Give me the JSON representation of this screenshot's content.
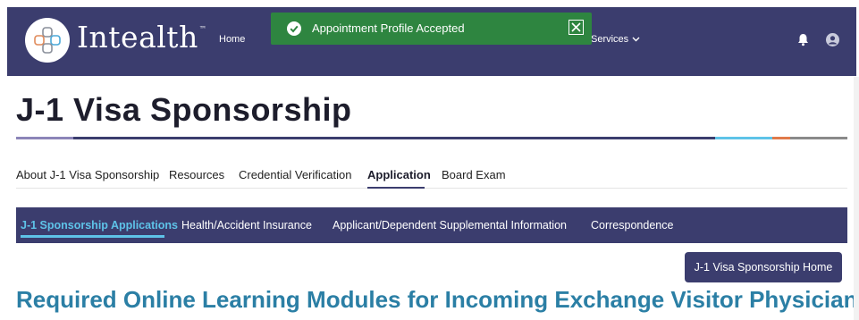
{
  "header": {
    "brand": "Intealth",
    "trademark": "™",
    "nav_home": "Home",
    "nav_services": "Services",
    "bg_color": "#3b3d6e"
  },
  "toast": {
    "message": "Appointment Profile Accepted",
    "color": "#2e8540",
    "icon": "check-icon"
  },
  "page": {
    "title": "J-1 Visa Sponsorship",
    "tabs": [
      {
        "label": "About J-1 Visa Sponsorship"
      },
      {
        "label": "Resources"
      },
      {
        "label": "Credential Verification"
      },
      {
        "label": "Application",
        "active": true
      },
      {
        "label": "Board Exam"
      }
    ],
    "subnav": [
      {
        "label": "J-1 Sponsorship Applications",
        "active": true
      },
      {
        "label": "Health/Accident Insurance"
      },
      {
        "label": "Applicant/Dependent Supplemental Information"
      },
      {
        "label": "Correspondence"
      }
    ],
    "home_button": "J-1 Visa Sponsorship Home",
    "section_title": "Required Online Learning Modules for Incoming Exchange Visitor Physicians",
    "accent_color": "#2b7fa5"
  }
}
